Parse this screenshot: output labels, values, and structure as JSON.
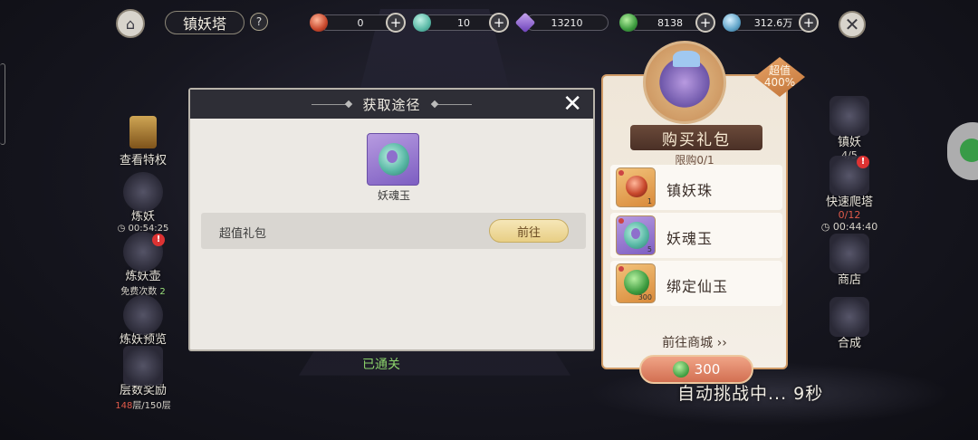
{
  "topbar": {
    "title": "镇妖塔",
    "help": "?",
    "home_glyph": "⌂",
    "close_glyph": "✕",
    "resources": [
      {
        "icon": "red-orb-icon",
        "value": "0",
        "color": "#c8482c"
      },
      {
        "icon": "jade-icon",
        "value": "10",
        "color": "#5ab9a6"
      },
      {
        "icon": "purple-crystal-icon",
        "value": "13210",
        "color": "#8a5fd0"
      },
      {
        "icon": "green-coin-icon",
        "value": "8138",
        "color": "#3d9b3f"
      },
      {
        "icon": "blue-gem-icon",
        "value": "312.6万",
        "color": "#5fa3c8"
      }
    ],
    "plus": "+"
  },
  "left_menu": [
    {
      "label": "查看特权"
    },
    {
      "label": "炼妖",
      "sub": "00:54:25"
    },
    {
      "label": "炼妖壶",
      "sub": "免费次数",
      "count": "2",
      "badge": "!"
    },
    {
      "label": "炼妖预览"
    },
    {
      "label": "层数奖励",
      "sub_red": "148",
      "sub": "层/150层"
    }
  ],
  "right_menu": [
    {
      "label": "镇妖",
      "sub": "4/5"
    },
    {
      "label": "快速爬塔",
      "sub_red": "0/12",
      "sub": "00:44:40",
      "badge": "!"
    },
    {
      "label": "商店"
    },
    {
      "label": "合成"
    }
  ],
  "dialog": {
    "title": "获取途径",
    "close_glyph": "✕",
    "item_name": "妖魂玉",
    "source_label": "超值礼包",
    "go_button": "前往"
  },
  "passed_text": "已通关",
  "gift": {
    "value_tag_1": "超值",
    "value_tag_2": "400%",
    "title": "购买礼包",
    "limit": "限购0/1",
    "items": [
      {
        "name": "镇妖珠",
        "count": "1"
      },
      {
        "name": "妖魂玉",
        "count": "5"
      },
      {
        "name": "绑定仙玉",
        "count": "300"
      }
    ],
    "goto_mall": "前往商城 ››",
    "price": "300"
  },
  "auto_challenge": "自动挑战中... 9秒"
}
